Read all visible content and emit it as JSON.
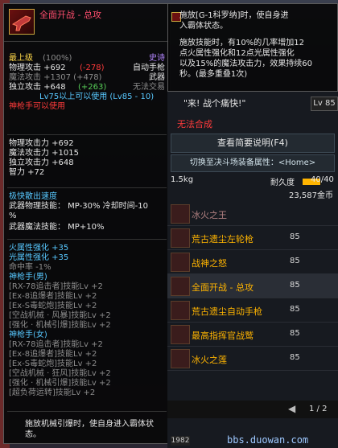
{
  "tooltip": {
    "title": "全面开战 - 总攻",
    "grade_line_left": "最上级",
    "grade_pct": "(100%)",
    "grade_right": "史诗",
    "phys_attack": "物理攻击 +692",
    "phys_attack_delta": "(-278)",
    "phys_attack_right": "自动手枪",
    "mag_attack": "魔法攻击 +1307 (+478)",
    "mag_attack_right": "武器",
    "indep_attack": "独立攻击 +648",
    "indep_attack_delta": "(+263)",
    "indep_attack_right": "无法交易",
    "level_req": "Lv75以上可以使用 (Lv85 - 10)",
    "class_req": "神枪手可以使用",
    "stats": [
      "物理攻击力 +692",
      "魔法攻击力 +1015",
      "独立攻击力 +648",
      "智力 +72"
    ],
    "speed_title": "极快散出速度",
    "mp_line1": "武器物理技能：  MP-30% 冷却时间-10",
    "mp_line1b": "%",
    "mp_line2": "武器魔法技能：   MP+10%",
    "fire": "火属性强化 +35",
    "light": "光属性强化 +35",
    "hit": "命中率 -1%",
    "gunner_male": "神枪手(男)",
    "skills_male": [
      "[RX-78追击者]技能Lv +2",
      "[Ex-8追爆者]技能Lv +2",
      "[Ex-S毒蛇炮]技能Lv +2",
      "[空战机械 · 风暴]技能Lv +2",
      "[强化 · 机械引爆]技能Lv +2"
    ],
    "gunner_female": "神枪手(女)",
    "skills_female": [
      "[RX-78追击者]技能Lv +2",
      "[Ex-8追爆者]技能Lv +2",
      "[Ex-S毒蛇炮]技能Lv +2",
      "[空战机械 · 狂风]技能Lv +2",
      "[强化 · 机械引爆]技能Lv +2",
      "[超负荷运转]技能Lv +2"
    ],
    "footer": "施放机械引爆时，使自身进入霸体状态。"
  },
  "right_tooltip": {
    "line1": "施放[G-1科罗纳]时，使自身进",
    "line2": "入霸体状态。",
    "line3": "施放技能时，有10%的几率增加12",
    "line4": "点火属性强化和12点光属性强化",
    "line5": "以及15%的魔法攻击力，效果持续60",
    "line6": "秒。(最多重叠1次)"
  },
  "panel": {
    "quote": "\"来! 战个痛快!\"",
    "lv_label": "Lv",
    "lv_value": "85",
    "cannot_combine": "无法合成",
    "view_desc": "查看简要说明(F4)",
    "switch_attr": "切换至决斗场装备属性：<Home>",
    "weight": "1.5kg",
    "durability_label": "耐久度",
    "durability_value": "40/40",
    "durability_fraction": 1.0,
    "price": "23,587金币",
    "items": [
      {
        "name": "",
        "level": ""
      },
      {
        "name": "荒古遗尘左轮枪",
        "level": "85"
      },
      {
        "name": "战神之怒",
        "level": "85"
      },
      {
        "name": "全面开战 - 总攻",
        "level": "85"
      },
      {
        "name": "荒古遗尘自动手枪",
        "level": "85"
      },
      {
        "name": "最高指挥官战鹫",
        "level": "85"
      },
      {
        "name": "冰火之莲",
        "level": "85"
      }
    ],
    "partial_top": "冰火之王",
    "page": "1 / 2"
  },
  "footer": {
    "watermark": "bbs.duowan.com",
    "badge": "1982"
  },
  "colors": {
    "orange": "#ffb400",
    "green": "#58d058",
    "red": "#ff3b3b",
    "cyan": "#58c8ff"
  }
}
